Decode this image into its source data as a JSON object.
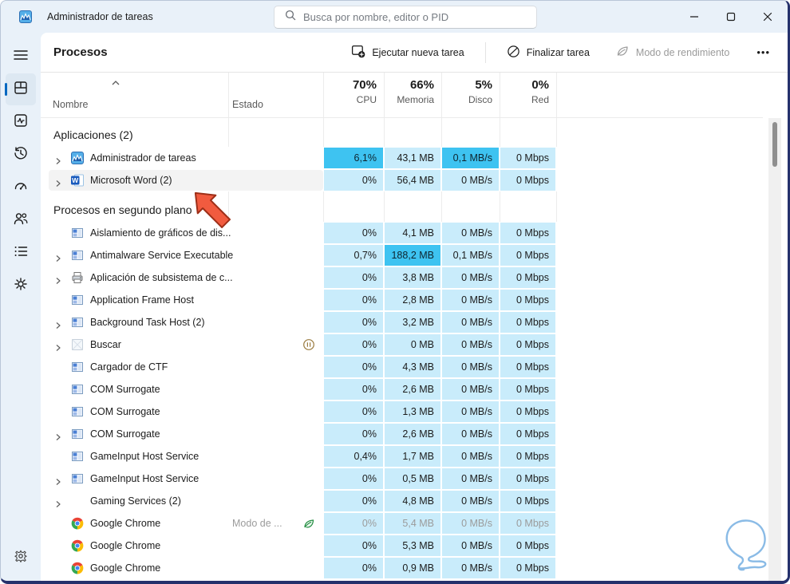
{
  "window": {
    "title": "Administrador de tareas",
    "controls": [
      {
        "icon": "minimize"
      },
      {
        "icon": "maximize"
      },
      {
        "icon": "close"
      }
    ]
  },
  "search": {
    "placeholder": "Busca por nombre, editor o PID"
  },
  "toolbar": {
    "page_title": "Procesos",
    "run_new_task": "Ejecutar nueva tarea",
    "end_task": "Finalizar tarea",
    "efficiency_mode": "Modo de rendimiento",
    "more": "•••"
  },
  "sidebar": {
    "items": [
      {
        "icon": "menu",
        "selected": false
      },
      {
        "icon": "processes",
        "selected": true
      },
      {
        "icon": "performance",
        "selected": false
      },
      {
        "icon": "app-history",
        "selected": false
      },
      {
        "icon": "startup-apps",
        "selected": false
      },
      {
        "icon": "users",
        "selected": false
      },
      {
        "icon": "details",
        "selected": false
      },
      {
        "icon": "services",
        "selected": false
      }
    ],
    "settings_icon": "settings"
  },
  "table": {
    "columns": {
      "name": "Nombre",
      "status": "Estado",
      "cpu": {
        "pct": "70%",
        "label": "CPU"
      },
      "memory": {
        "pct": "66%",
        "label": "Memoria"
      },
      "disk": {
        "pct": "5%",
        "label": "Disco"
      },
      "net": {
        "pct": "0%",
        "label": "Red"
      }
    },
    "groups": [
      {
        "label": "Aplicaciones (2)",
        "rows": [
          {
            "name": "Administrador de tareas",
            "icon": "taskmgr",
            "chevron": true,
            "cpu": "6,1%",
            "mem": "43,1 MB",
            "disk": "0,1 MB/s",
            "net": "0 Mbps",
            "hot": [
              "cpu",
              "disk"
            ]
          },
          {
            "name": "Microsoft Word (2)",
            "icon": "word",
            "chevron": true,
            "hover": true,
            "cpu": "0%",
            "mem": "56,4 MB",
            "disk": "0 MB/s",
            "net": "0 Mbps",
            "hot": []
          }
        ]
      },
      {
        "label": "Procesos en segundo plano",
        "rows": [
          {
            "name": "Aislamiento de gráficos de dis...",
            "icon": "exe",
            "chevron": false,
            "cpu": "0%",
            "mem": "4,1 MB",
            "disk": "0 MB/s",
            "net": "0 Mbps",
            "hot": []
          },
          {
            "name": "Antimalware Service Executable",
            "icon": "exe",
            "chevron": true,
            "cpu": "0,7%",
            "mem": "188,2 MB",
            "disk": "0,1 MB/s",
            "net": "0 Mbps",
            "hot": [
              "mem"
            ]
          },
          {
            "name": "Aplicación de subsistema de c...",
            "icon": "printer",
            "chevron": true,
            "cpu": "0%",
            "mem": "3,8 MB",
            "disk": "0 MB/s",
            "net": "0 Mbps",
            "hot": []
          },
          {
            "name": "Application Frame Host",
            "icon": "exe",
            "chevron": false,
            "cpu": "0%",
            "mem": "2,8 MB",
            "disk": "0 MB/s",
            "net": "0 Mbps",
            "hot": []
          },
          {
            "name": "Background Task Host (2)",
            "icon": "exe",
            "chevron": true,
            "cpu": "0%",
            "mem": "3,2 MB",
            "disk": "0 MB/s",
            "net": "0 Mbps",
            "hot": []
          },
          {
            "name": "Buscar",
            "icon": "faded",
            "chevron": true,
            "status_icon": "suspended-pause",
            "cpu": "0%",
            "mem": "0 MB",
            "disk": "0 MB/s",
            "net": "0 Mbps",
            "hot": []
          },
          {
            "name": "Cargador de CTF",
            "icon": "exe",
            "chevron": false,
            "cpu": "0%",
            "mem": "4,3 MB",
            "disk": "0 MB/s",
            "net": "0 Mbps",
            "hot": []
          },
          {
            "name": "COM Surrogate",
            "icon": "exe",
            "chevron": false,
            "cpu": "0%",
            "mem": "2,6 MB",
            "disk": "0 MB/s",
            "net": "0 Mbps",
            "hot": []
          },
          {
            "name": "COM Surrogate",
            "icon": "exe",
            "chevron": false,
            "cpu": "0%",
            "mem": "1,3 MB",
            "disk": "0 MB/s",
            "net": "0 Mbps",
            "hot": []
          },
          {
            "name": "COM Surrogate",
            "icon": "exe",
            "chevron": true,
            "cpu": "0%",
            "mem": "2,6 MB",
            "disk": "0 MB/s",
            "net": "0 Mbps",
            "hot": []
          },
          {
            "name": "GameInput Host Service",
            "icon": "exe",
            "chevron": false,
            "cpu": "0,4%",
            "mem": "1,7 MB",
            "disk": "0 MB/s",
            "net": "0 Mbps",
            "hot": []
          },
          {
            "name": "GameInput Host Service",
            "icon": "exe",
            "chevron": true,
            "cpu": "0%",
            "mem": "0,5 MB",
            "disk": "0 MB/s",
            "net": "0 Mbps",
            "hot": []
          },
          {
            "name": "Gaming Services (2)",
            "icon": "none",
            "chevron": true,
            "cpu": "0%",
            "mem": "4,8 MB",
            "disk": "0 MB/s",
            "net": "0 Mbps",
            "hot": []
          },
          {
            "name": "Google Chrome",
            "icon": "chrome",
            "chevron": false,
            "status_text": "Modo de ...",
            "status_icon": "efficiency-leaf",
            "dim": true,
            "cpu": "0%",
            "mem": "5,4 MB",
            "disk": "0 MB/s",
            "net": "0 Mbps",
            "hot": []
          },
          {
            "name": "Google Chrome",
            "icon": "chrome",
            "chevron": false,
            "cpu": "0%",
            "mem": "5,3 MB",
            "disk": "0 MB/s",
            "net": "0 Mbps",
            "hot": []
          },
          {
            "name": "Google Chrome",
            "icon": "chrome",
            "chevron": false,
            "cpu": "0%",
            "mem": "0,9 MB",
            "disk": "0 MB/s",
            "net": "0 Mbps",
            "hot": []
          }
        ]
      }
    ]
  },
  "colors": {
    "cell_light": "#c9ecfb",
    "cell_highlight": "#3ec3f1",
    "accent": "#0067c0",
    "arrow_fill": "#f15b3f",
    "arrow_stroke": "#9e2f18",
    "watermark": "#8abbe6"
  }
}
